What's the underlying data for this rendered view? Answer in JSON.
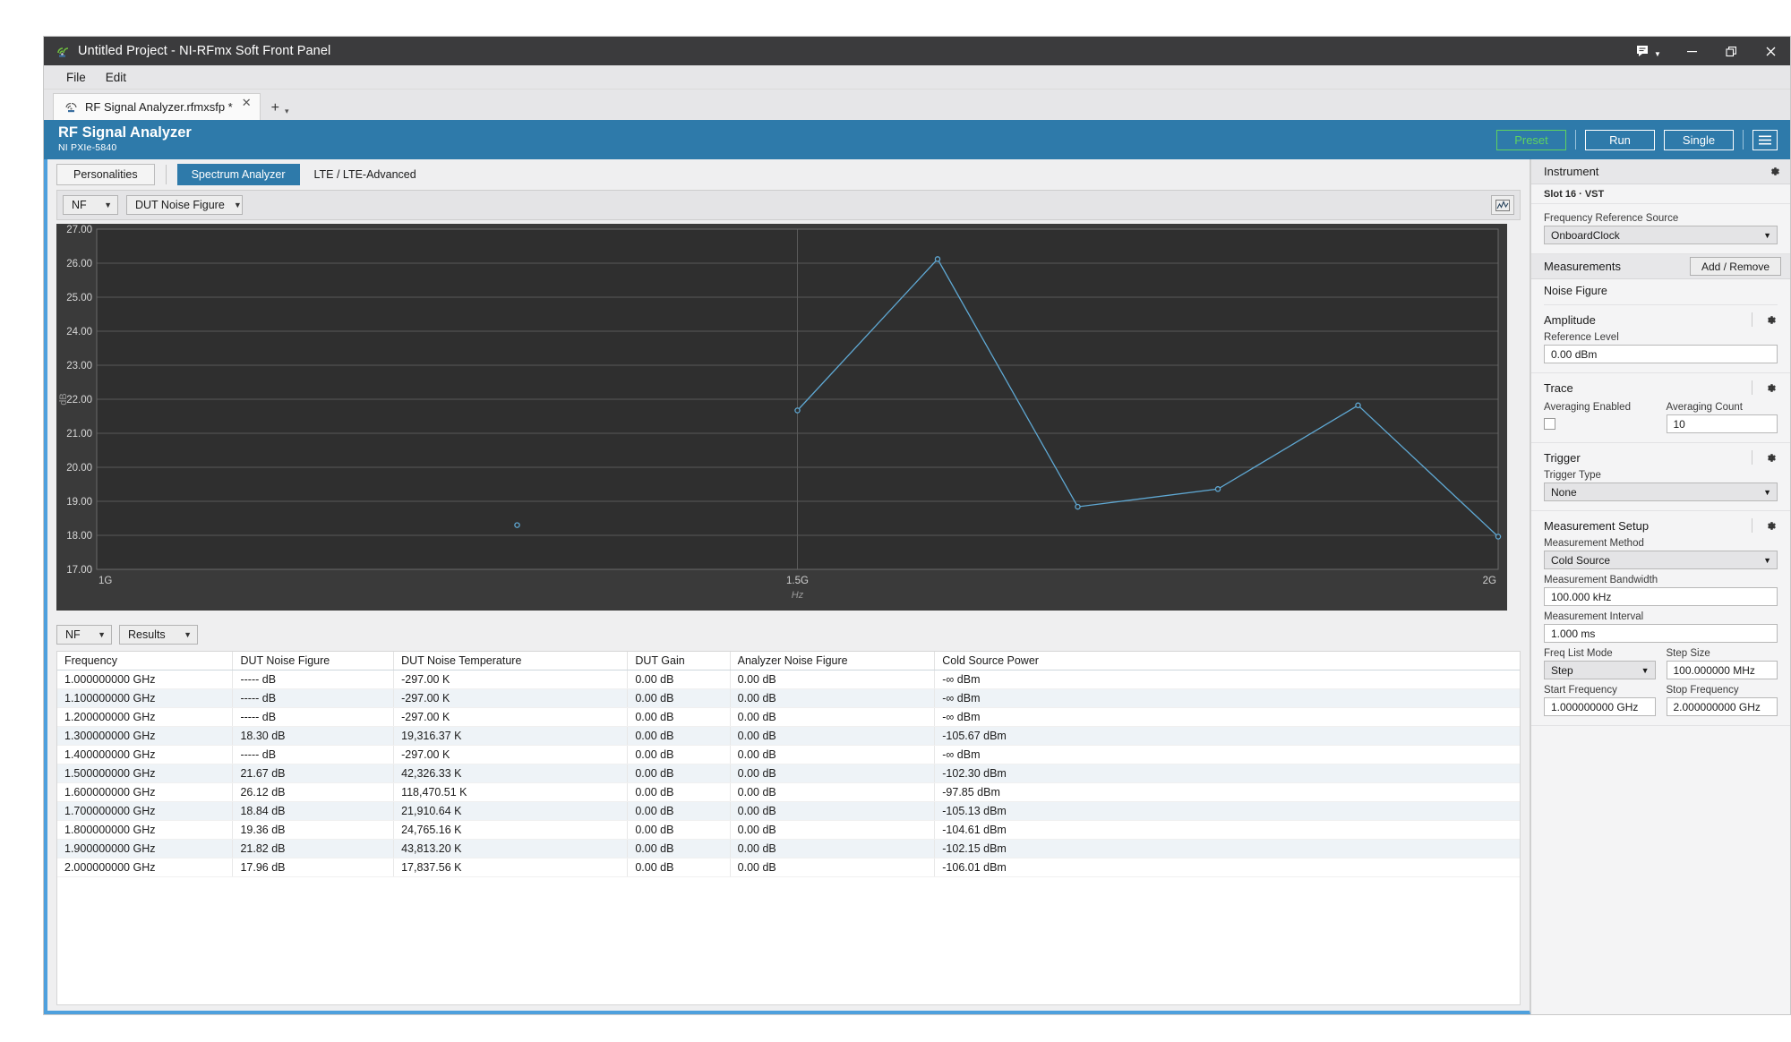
{
  "window": {
    "title": "Untitled Project - NI-RFmx Soft Front Panel",
    "app_icon": "ni-rfmx-icon",
    "feedback_icon": "feedback-chat-icon",
    "minimize": "—",
    "restore": "❐",
    "close": "✕"
  },
  "menu": {
    "items": [
      "File",
      "Edit"
    ]
  },
  "tabstrip": {
    "document_tab": "RF Signal Analyzer.rfmxsfp *",
    "close_glyph": "✕",
    "add_glyph": "+",
    "caret_glyph": "▾"
  },
  "header": {
    "title": "RF Signal Analyzer",
    "subtitle": "NI PXIe-5840",
    "preset_label": "Preset",
    "run_label": "Run",
    "single_label": "Single",
    "menu_icon": "hamburger-menu-icon",
    "preset_color": "#5fd35f"
  },
  "personalities": {
    "button_label": "Personalities",
    "tabs": [
      {
        "label": "Spectrum Analyzer",
        "active": true
      },
      {
        "label": "LTE / LTE-Advanced",
        "active": false
      }
    ]
  },
  "graph_toolbar": {
    "measurement_select": "NF",
    "trace_select": "DUT Noise Figure",
    "graph_icon": "waveform-graph-icon",
    "caret_glyph": "▼"
  },
  "results_toolbar": {
    "measurement_select": "NF",
    "view_select": "Results",
    "caret_glyph": "▼"
  },
  "chart_data": {
    "type": "line",
    "title": "",
    "xlabel": "Hz",
    "ylabel": "dB",
    "xlim": [
      1000000000.0,
      2000000000.0
    ],
    "ylim": [
      17.0,
      27.0
    ],
    "xticks": [
      1000000000.0,
      1500000000.0,
      2000000000.0
    ],
    "xtick_labels": [
      "1G",
      "1.5G",
      "2G"
    ],
    "yticks": [
      17.0,
      18.0,
      19.0,
      20.0,
      21.0,
      22.0,
      23.0,
      24.0,
      25.0,
      26.0,
      27.0
    ],
    "ytick_labels": [
      "17.00",
      "18.00",
      "19.00",
      "20.00",
      "21.00",
      "22.00",
      "23.00",
      "24.00",
      "25.00",
      "26.00",
      "27.00"
    ],
    "grid": true,
    "legend": "none",
    "series": [
      {
        "name": "DUT Noise Figure",
        "color": "#5fa8d3",
        "x": [
          1300000000.0,
          1500000000.0,
          1600000000.0,
          1700000000.0,
          1800000000.0,
          1900000000.0,
          2000000000.0
        ],
        "values": [
          18.3,
          21.67,
          26.12,
          18.84,
          19.36,
          21.82,
          17.96
        ],
        "gaps_before": [
          1000000000.0,
          1100000000.0,
          1200000000.0,
          1400000000.0
        ]
      }
    ],
    "plot_bg": "#2f2f2f",
    "grid_color": "#5a5a5a"
  },
  "table": {
    "columns": [
      "Frequency",
      "DUT Noise Figure",
      "DUT Noise Temperature",
      "DUT Gain",
      "Analyzer Noise Figure",
      "Cold Source Power"
    ],
    "rows": [
      [
        "1.000000000 GHz",
        "----- dB",
        "-297.00 K",
        "0.00 dB",
        "0.00 dB",
        "-∞ dBm"
      ],
      [
        "1.100000000 GHz",
        "----- dB",
        "-297.00 K",
        "0.00 dB",
        "0.00 dB",
        "-∞ dBm"
      ],
      [
        "1.200000000 GHz",
        "----- dB",
        "-297.00 K",
        "0.00 dB",
        "0.00 dB",
        "-∞ dBm"
      ],
      [
        "1.300000000 GHz",
        "18.30 dB",
        "19,316.37 K",
        "0.00 dB",
        "0.00 dB",
        "-105.67 dBm"
      ],
      [
        "1.400000000 GHz",
        "----- dB",
        "-297.00 K",
        "0.00 dB",
        "0.00 dB",
        "-∞ dBm"
      ],
      [
        "1.500000000 GHz",
        "21.67 dB",
        "42,326.33 K",
        "0.00 dB",
        "0.00 dB",
        "-102.30 dBm"
      ],
      [
        "1.600000000 GHz",
        "26.12 dB",
        "118,470.51 K",
        "0.00 dB",
        "0.00 dB",
        "-97.85 dBm"
      ],
      [
        "1.700000000 GHz",
        "18.84 dB",
        "21,910.64 K",
        "0.00 dB",
        "0.00 dB",
        "-105.13 dBm"
      ],
      [
        "1.800000000 GHz",
        "19.36 dB",
        "24,765.16 K",
        "0.00 dB",
        "0.00 dB",
        "-104.61 dBm"
      ],
      [
        "1.900000000 GHz",
        "21.82 dB",
        "43,813.20 K",
        "0.00 dB",
        "0.00 dB",
        "-102.15 dBm"
      ],
      [
        "2.000000000 GHz",
        "17.96 dB",
        "17,837.56 K",
        "0.00 dB",
        "0.00 dB",
        "-106.01 dBm"
      ]
    ]
  },
  "panel": {
    "instrument": {
      "header": "Instrument",
      "gear_icon": "gear-icon",
      "slot_line": "Slot 16  ·  VST",
      "freq_ref_label": "Frequency Reference Source",
      "freq_ref_value": "OnboardClock"
    },
    "measurements": {
      "header": "Measurements",
      "add_remove_label": "Add / Remove",
      "measurement_name": "Noise Figure"
    },
    "amplitude": {
      "header": "Amplitude",
      "gear_icon": "gear-icon",
      "reference_level_label": "Reference Level",
      "reference_level_value": "0.00 dBm"
    },
    "trace": {
      "header": "Trace",
      "gear_icon": "gear-icon",
      "averaging_enabled_label": "Averaging Enabled",
      "averaging_enabled_checked": false,
      "averaging_count_label": "Averaging Count",
      "averaging_count_value": "10"
    },
    "trigger": {
      "header": "Trigger",
      "gear_icon": "gear-icon",
      "trigger_type_label": "Trigger Type",
      "trigger_type_value": "None"
    },
    "measurement_setup": {
      "header": "Measurement Setup",
      "gear_icon": "gear-icon",
      "method_label": "Measurement Method",
      "method_value": "Cold Source",
      "bandwidth_label": "Measurement Bandwidth",
      "bandwidth_value": "100.000 kHz",
      "interval_label": "Measurement Interval",
      "interval_value": "1.000 ms",
      "freq_list_mode_label": "Freq List Mode",
      "freq_list_mode_value": "Step",
      "step_size_label": "Step Size",
      "step_size_value": "100.000000 MHz",
      "start_freq_label": "Start Frequency",
      "start_freq_value": "1.000000000 GHz",
      "stop_freq_label": "Stop Frequency",
      "stop_freq_value": "2.000000000 GHz"
    },
    "caret_glyph": "▼"
  }
}
